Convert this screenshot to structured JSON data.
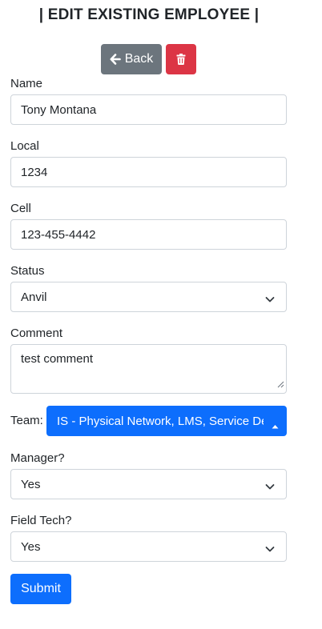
{
  "header": {
    "title": "| EDIT EXISTING EMPLOYEE |"
  },
  "toolbar": {
    "back_label": "Back"
  },
  "form": {
    "name": {
      "label": "Name",
      "value": "Tony Montana"
    },
    "local": {
      "label": "Local",
      "value": "1234"
    },
    "cell": {
      "label": "Cell",
      "value": "123-455-4442"
    },
    "status": {
      "label": "Status",
      "value": "Anvil"
    },
    "comment": {
      "label": "Comment",
      "value": "test comment"
    },
    "team": {
      "label": "Team:",
      "value": "IS - Physical Network, LMS, Service Desk"
    },
    "manager": {
      "label": "Manager?",
      "value": "Yes"
    },
    "field_tech": {
      "label": "Field Tech?",
      "value": "Yes"
    },
    "submit_label": "Submit"
  },
  "colors": {
    "primary": "#0d6efd",
    "secondary": "#6c757d",
    "danger": "#dc3545"
  },
  "icons": {
    "back": "arrow-left-icon",
    "delete": "trash-icon",
    "select": "chevron-down-icon",
    "team_select": "caret-up-icon"
  }
}
